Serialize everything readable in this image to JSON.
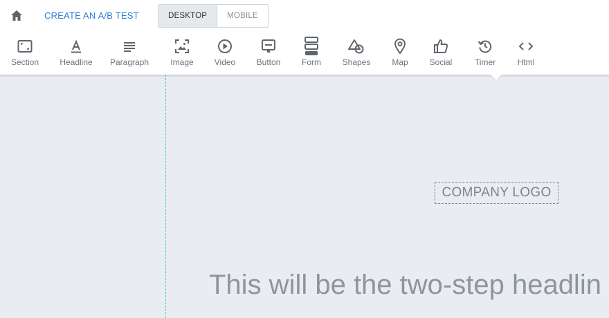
{
  "header": {
    "ab_test_label": "CREATE AN A/B TEST",
    "view_modes": [
      "DESKTOP",
      "MOBILE"
    ],
    "active_view": "DESKTOP"
  },
  "toolbar": {
    "items": [
      {
        "label": "Section",
        "icon": "section-icon"
      },
      {
        "label": "Headline",
        "icon": "headline-icon"
      },
      {
        "label": "Paragraph",
        "icon": "paragraph-icon"
      },
      {
        "label": "Image",
        "icon": "image-icon"
      },
      {
        "label": "Video",
        "icon": "video-icon"
      },
      {
        "label": "Button",
        "icon": "button-icon"
      },
      {
        "label": "Form",
        "icon": "form-icon"
      },
      {
        "label": "Shapes",
        "icon": "shapes-icon"
      },
      {
        "label": "Map",
        "icon": "map-icon"
      },
      {
        "label": "Social",
        "icon": "social-icon"
      },
      {
        "label": "Timer",
        "icon": "timer-icon"
      },
      {
        "label": "Html",
        "icon": "html-icon"
      }
    ]
  },
  "canvas": {
    "logo_placeholder": "COMPANY LOGO",
    "headline": "This will be the two-step headlin"
  },
  "colors": {
    "accent": "#2a7fd4",
    "canvas_bg": "#e9edf1",
    "guide": "#4cc3d9",
    "icon": "#5f656c"
  }
}
